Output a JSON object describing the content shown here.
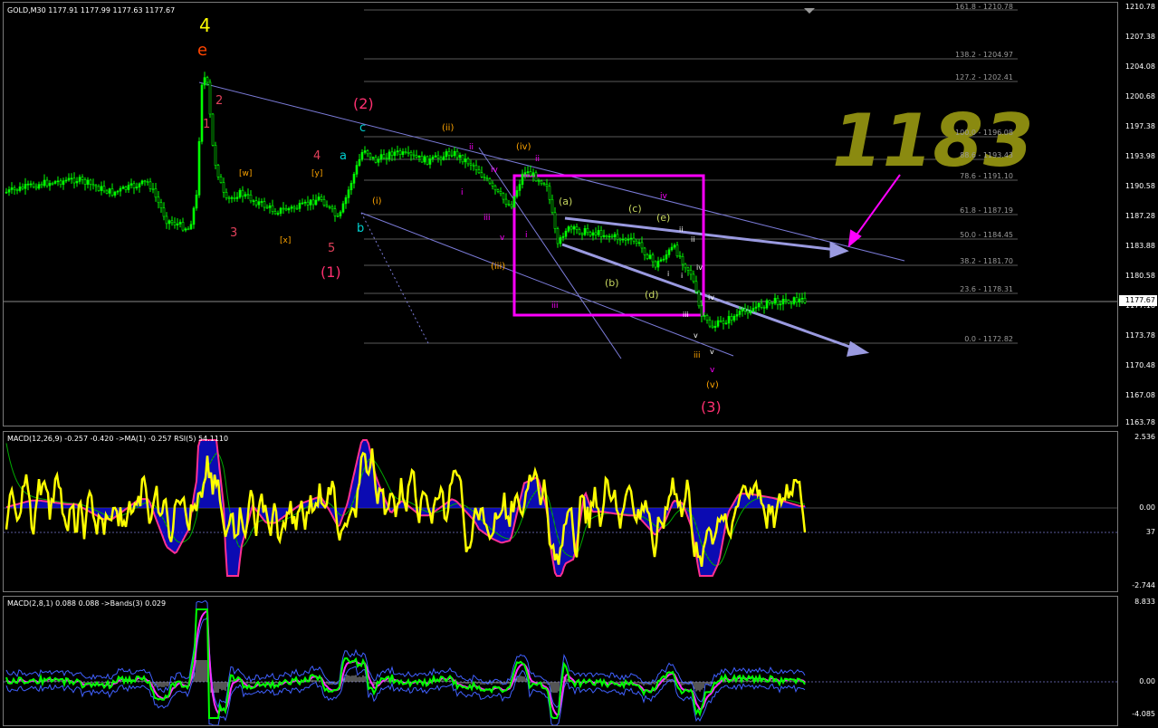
{
  "main_pane": {
    "header": "GOLD,M30  1177.91 1177.99 1177.63 1177.67",
    "current_price": "1177.67",
    "price_axis": [
      "1210.78",
      "1207.38",
      "1204.08",
      "1200.68",
      "1197.38",
      "1193.98",
      "1190.58",
      "1187.28",
      "1183.88",
      "1180.58",
      "1177.18",
      "1173.78",
      "1170.48",
      "1167.08",
      "1163.78"
    ],
    "fib_levels": [
      "161.8 - 1210.78",
      "138.2 - 1204.97",
      "127.2 - 1202.41",
      "100.0 - 1196.08",
      "88.6 - 1193.43",
      "78.6 - 1191.10",
      "61.8 - 1187.19",
      "50.0 - 1184.45",
      "38.2 - 1181.70",
      "23.6 - 1178.31",
      "0.0 - 1172.82"
    ],
    "annotation_text": "1183",
    "wave_labels": {
      "w4": "4",
      "we": "e",
      "w1a": "1",
      "w2a": "2",
      "w3a": "3",
      "ww": "[w]",
      "wy": "[y]",
      "wx": "[x]",
      "w4b": "4",
      "w5": "5",
      "wa": "a",
      "wb": "b",
      "wc": "c",
      "W1": "(1)",
      "W2": "(2)",
      "W3": "(3)",
      "wi1": "(i)",
      "wii": "(ii)",
      "wiii": "(iii)",
      "wiv": "(iv)",
      "wv": "(v)",
      "ri": "i",
      "rii": "ii",
      "riii": "iii",
      "riv": "iv",
      "rv": "v",
      "ri2": "i",
      "rii2": "ii",
      "riii2": "iii",
      "riv2": "iv",
      "rv2": "v",
      "pa": "(a)",
      "pb": "(b)",
      "pc": "(c)",
      "pd": "(d)",
      "pe": "(e)",
      "si": "i",
      "sii": "ii",
      "siii": "iii",
      "siv": "iv",
      "sv": "v",
      "si2": "i",
      "sii2": "ii",
      "siii2": "iii",
      "siv2": "iv",
      "sv2": "v"
    }
  },
  "macd1_pane": {
    "header": "MACD(12,26,9) -0.257 -0.420  ->MA(1) -0.257  RSI(5) 54.1110",
    "axis": [
      "2.536",
      "0.00",
      "37",
      "-2.744"
    ]
  },
  "macd2_pane": {
    "header": "MACD(2,8,1) 0.088 0.088  ->Bands(3) 0.029",
    "axis": [
      "8.833",
      "0.00",
      "-4.085"
    ]
  },
  "colors": {
    "candles": "#00ff00",
    "fib": "#9a9a9a",
    "trend": "#7b7bd8",
    "magenta": "#ff00ff",
    "yellow": "#ffff00",
    "macd_hist": "#0000ff",
    "annotation": "#8a8a10"
  }
}
